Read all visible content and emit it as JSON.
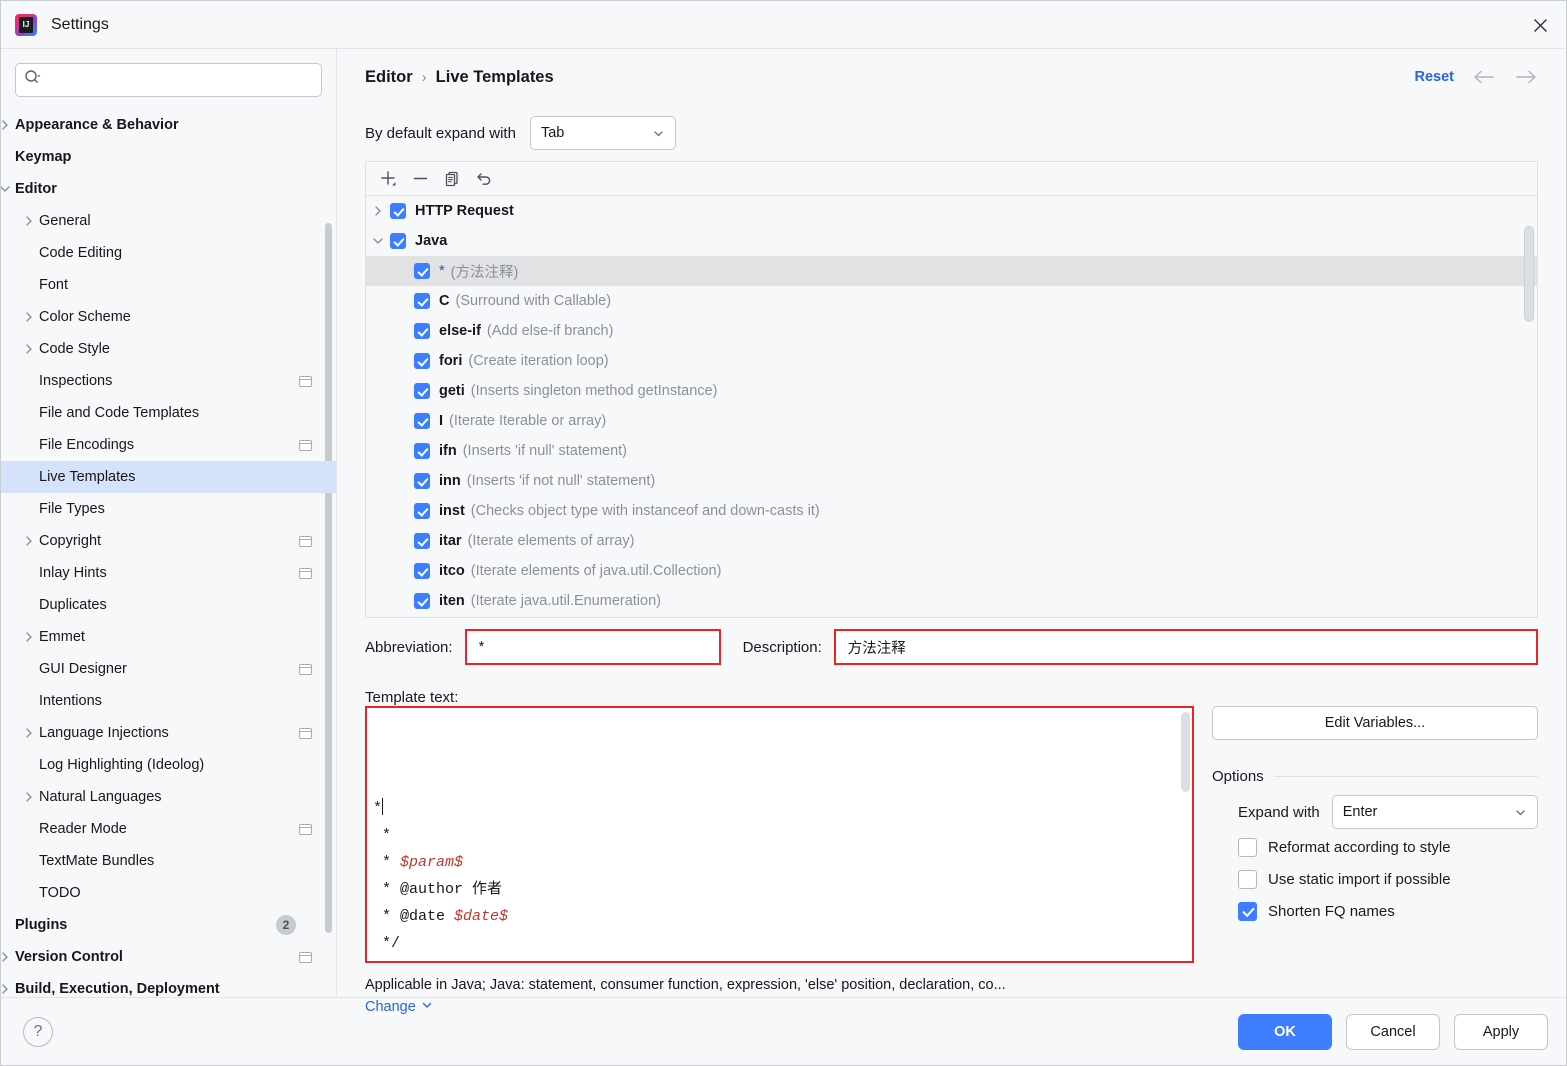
{
  "window": {
    "title": "Settings",
    "logo_icon": "intellij-idea-logo",
    "close_icon": "close-icon"
  },
  "sidebar": {
    "search": {
      "placeholder": "",
      "value": "",
      "icon": "search-icon"
    },
    "items": [
      {
        "label": "Appearance & Behavior",
        "level": 0,
        "bold": true,
        "twisty": "right",
        "copyable": false
      },
      {
        "label": "Keymap",
        "level": 0,
        "bold": true,
        "twisty": "none",
        "copyable": false
      },
      {
        "label": "Editor",
        "level": 0,
        "bold": true,
        "twisty": "down",
        "copyable": false
      },
      {
        "label": "General",
        "level": 1,
        "bold": false,
        "twisty": "right",
        "copyable": false
      },
      {
        "label": "Code Editing",
        "level": 1,
        "bold": false,
        "twisty": "none",
        "copyable": false
      },
      {
        "label": "Font",
        "level": 1,
        "bold": false,
        "twisty": "none",
        "copyable": false
      },
      {
        "label": "Color Scheme",
        "level": 1,
        "bold": false,
        "twisty": "right",
        "copyable": false
      },
      {
        "label": "Code Style",
        "level": 1,
        "bold": false,
        "twisty": "right",
        "copyable": false
      },
      {
        "label": "Inspections",
        "level": 1,
        "bold": false,
        "twisty": "none",
        "copyable": true
      },
      {
        "label": "File and Code Templates",
        "level": 1,
        "bold": false,
        "twisty": "none",
        "copyable": false
      },
      {
        "label": "File Encodings",
        "level": 1,
        "bold": false,
        "twisty": "none",
        "copyable": true
      },
      {
        "label": "Live Templates",
        "level": 1,
        "bold": false,
        "twisty": "none",
        "copyable": false,
        "selected": true
      },
      {
        "label": "File Types",
        "level": 1,
        "bold": false,
        "twisty": "none",
        "copyable": false
      },
      {
        "label": "Copyright",
        "level": 1,
        "bold": false,
        "twisty": "right",
        "copyable": true
      },
      {
        "label": "Inlay Hints",
        "level": 1,
        "bold": false,
        "twisty": "none",
        "copyable": true
      },
      {
        "label": "Duplicates",
        "level": 1,
        "bold": false,
        "twisty": "none",
        "copyable": false
      },
      {
        "label": "Emmet",
        "level": 1,
        "bold": false,
        "twisty": "right",
        "copyable": false
      },
      {
        "label": "GUI Designer",
        "level": 1,
        "bold": false,
        "twisty": "none",
        "copyable": true
      },
      {
        "label": "Intentions",
        "level": 1,
        "bold": false,
        "twisty": "none",
        "copyable": false
      },
      {
        "label": "Language Injections",
        "level": 1,
        "bold": false,
        "twisty": "right",
        "copyable": true
      },
      {
        "label": "Log Highlighting (Ideolog)",
        "level": 1,
        "bold": false,
        "twisty": "none",
        "copyable": false
      },
      {
        "label": "Natural Languages",
        "level": 1,
        "bold": false,
        "twisty": "right",
        "copyable": false
      },
      {
        "label": "Reader Mode",
        "level": 1,
        "bold": false,
        "twisty": "none",
        "copyable": true
      },
      {
        "label": "TextMate Bundles",
        "level": 1,
        "bold": false,
        "twisty": "none",
        "copyable": false
      },
      {
        "label": "TODO",
        "level": 1,
        "bold": false,
        "twisty": "none",
        "copyable": false
      },
      {
        "label": "Plugins",
        "level": 0,
        "bold": true,
        "twisty": "none",
        "copyable": false,
        "badge": "2"
      },
      {
        "label": "Version Control",
        "level": 0,
        "bold": true,
        "twisty": "right",
        "copyable": true
      },
      {
        "label": "Build, Execution, Deployment",
        "level": 0,
        "bold": true,
        "twisty": "right",
        "copyable": false
      }
    ]
  },
  "breadcrumb": {
    "parent": "Editor",
    "separator": "›",
    "current": "Live Templates",
    "reset_label": "Reset",
    "back_icon": "arrow-left-icon",
    "forward_icon": "arrow-right-icon"
  },
  "expand_with": {
    "label": "By default expand with",
    "value": "Tab",
    "caret_icon": "chevron-down-icon"
  },
  "toolbar": {
    "add_icon": "plus-icon",
    "remove_icon": "minus-icon",
    "duplicate_icon": "copy-icon",
    "revert_icon": "undo-arrow-icon"
  },
  "template_list": {
    "rows": [
      {
        "indent": 0,
        "twisty": "right",
        "checked": true,
        "name": "HTTP Request",
        "group": true
      },
      {
        "indent": 0,
        "twisty": "down",
        "checked": true,
        "name": "Java",
        "group": true
      },
      {
        "indent": 1,
        "twisty": "none",
        "checked": true,
        "abbr": "*",
        "desc": "(方法注释)",
        "selected": true,
        "star": true
      },
      {
        "indent": 1,
        "twisty": "none",
        "checked": true,
        "abbr": "C",
        "desc": "(Surround with Callable)"
      },
      {
        "indent": 1,
        "twisty": "none",
        "checked": true,
        "abbr": "else-if",
        "desc": "(Add else-if branch)"
      },
      {
        "indent": 1,
        "twisty": "none",
        "checked": true,
        "abbr": "fori",
        "desc": "(Create iteration loop)"
      },
      {
        "indent": 1,
        "twisty": "none",
        "checked": true,
        "abbr": "geti",
        "desc": "(Inserts singleton method getInstance)"
      },
      {
        "indent": 1,
        "twisty": "none",
        "checked": true,
        "abbr": "I",
        "desc": "(Iterate Iterable or array)"
      },
      {
        "indent": 1,
        "twisty": "none",
        "checked": true,
        "abbr": "ifn",
        "desc": "(Inserts 'if null' statement)"
      },
      {
        "indent": 1,
        "twisty": "none",
        "checked": true,
        "abbr": "inn",
        "desc": "(Inserts 'if not null' statement)"
      },
      {
        "indent": 1,
        "twisty": "none",
        "checked": true,
        "abbr": "inst",
        "desc": "(Checks object type with instanceof and down-casts it)"
      },
      {
        "indent": 1,
        "twisty": "none",
        "checked": true,
        "abbr": "itar",
        "desc": "(Iterate elements of array)"
      },
      {
        "indent": 1,
        "twisty": "none",
        "checked": true,
        "abbr": "itco",
        "desc": "(Iterate elements of java.util.Collection)"
      },
      {
        "indent": 1,
        "twisty": "none",
        "checked": true,
        "abbr": "iten",
        "desc": "(Iterate java.util.Enumeration)"
      }
    ]
  },
  "abbreviation": {
    "label": "Abbreviation:",
    "value": "*"
  },
  "description": {
    "label": "Description:",
    "value": "方法注释"
  },
  "template_text": {
    "label": "Template text:",
    "lines": [
      {
        "prefix": "*",
        "caret": true
      },
      {
        "prefix": " *"
      },
      {
        "prefix": " * ",
        "var": "$param$"
      },
      {
        "prefix": " * @author 作者"
      },
      {
        "prefix": " * @date ",
        "var": "$date$"
      },
      {
        "prefix": " */"
      }
    ]
  },
  "right_panel": {
    "edit_variables_label": "Edit Variables...",
    "options_title": "Options",
    "expand_with_label": "Expand with",
    "expand_with_value": "Enter",
    "checkboxes": [
      {
        "label": "Reformat according to style",
        "checked": false
      },
      {
        "label": "Use static import if possible",
        "checked": false
      },
      {
        "label": "Shorten FQ names",
        "checked": true
      }
    ]
  },
  "applicable": {
    "text": "Applicable in Java; Java: statement, consumer function, expression, 'else' position, declaration, co...",
    "change_label": "Change",
    "change_caret_icon": "chevron-down-icon"
  },
  "footer": {
    "help_icon": "help-icon",
    "ok_label": "OK",
    "cancel_label": "Cancel",
    "apply_label": "Apply"
  },
  "colors": {
    "accent": "#3d7eff",
    "link": "#2b63d9",
    "highlight_border": "#ee2222",
    "selection": "#d4e2fc",
    "list_selection": "#e1e2e4"
  }
}
